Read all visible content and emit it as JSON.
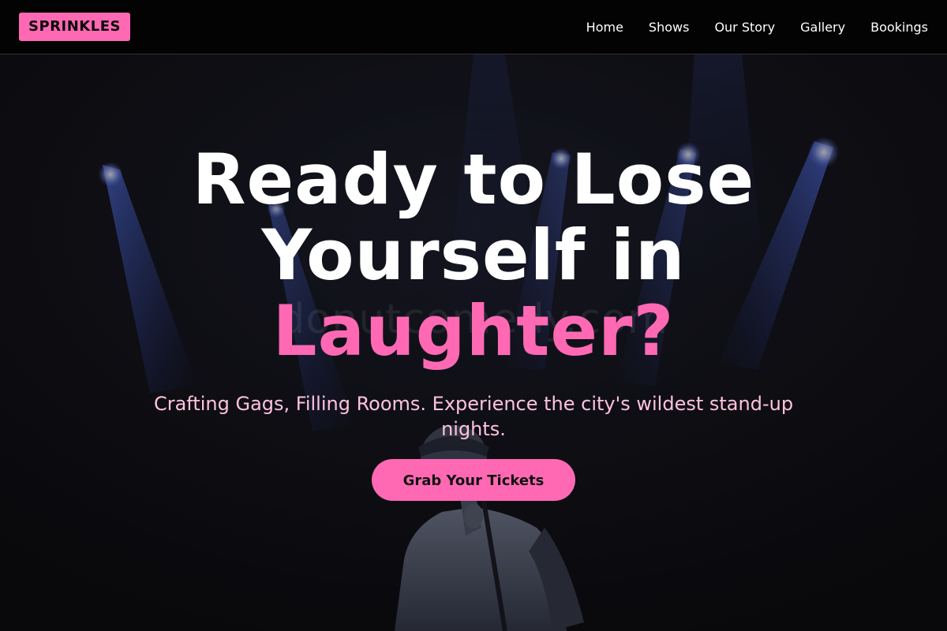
{
  "brand": {
    "logo_text": "SPRINKLES",
    "accent_color": "#ff69b4"
  },
  "nav": {
    "items": [
      {
        "label": "Home"
      },
      {
        "label": "Shows"
      },
      {
        "label": "Our Story"
      },
      {
        "label": "Gallery"
      },
      {
        "label": "Bookings"
      }
    ]
  },
  "hero": {
    "headline_line1": "Ready to Lose",
    "headline_line2": "Yourself in",
    "headline_accent": "Laughter?",
    "subtitle": "Crafting Gags, Filling Rooms. Experience the city's wildest stand-up nights.",
    "cta_label": "Grab Your Tickets",
    "watermark": "donutcomedy.com",
    "background_description_icon": "stage-performer-image"
  }
}
